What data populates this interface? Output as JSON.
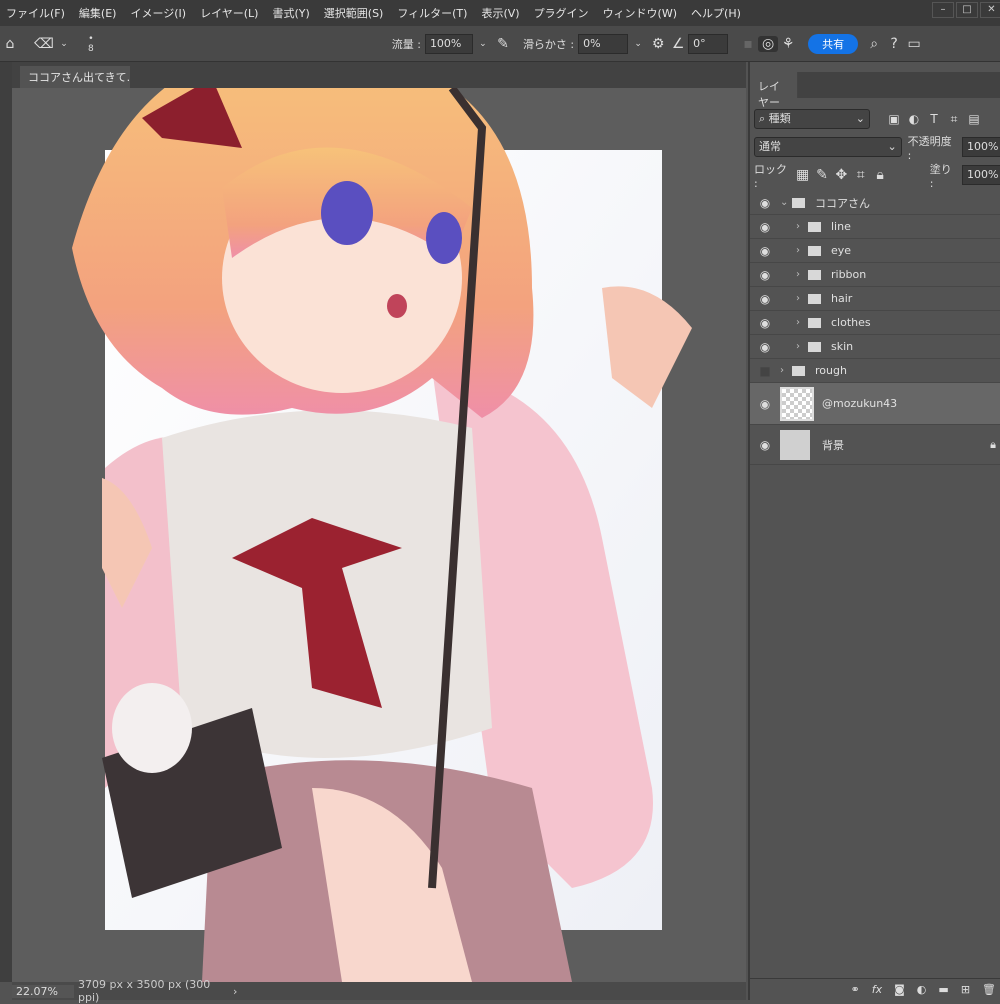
{
  "menu": [
    "ファイル(F)",
    "編集(E)",
    "イメージ(I)",
    "レイヤー(L)",
    "書式(Y)",
    "選択範囲(S)",
    "フィルター(T)",
    "表示(V)",
    "プラグイン",
    "ウィンドウ(W)",
    "ヘルプ(H)"
  ],
  "options": {
    "brush_size": "8",
    "flow_label": "流量 :",
    "flow_value": "100%",
    "smoothing_label": "滑らかさ :",
    "smoothing_value": "0%",
    "angle_value": "0°",
    "share_label": "共有"
  },
  "document": {
    "tab_title": "ココアさん出てきて.psd",
    "zoom": "22.07%",
    "size_info": "3709 px x 3500 px (300 ppi)"
  },
  "layers_panel": {
    "tab": "レイヤー",
    "filter_kind": "種類",
    "blend_mode": "通常",
    "opacity_label": "不透明度 :",
    "opacity_value": "100%",
    "lock_label": "ロック :",
    "fill_label": "塗り :",
    "fill_value": "100%",
    "layers": [
      {
        "name": "ココアさん",
        "type": "group",
        "visible": true,
        "expanded": true
      },
      {
        "name": "line",
        "type": "group",
        "visible": true
      },
      {
        "name": "eye",
        "type": "group",
        "visible": true
      },
      {
        "name": "ribbon",
        "type": "group",
        "visible": true
      },
      {
        "name": "hair",
        "type": "group",
        "visible": true
      },
      {
        "name": "clothes",
        "type": "group",
        "visible": true
      },
      {
        "name": "skin",
        "type": "group",
        "visible": true
      },
      {
        "name": "rough",
        "type": "group",
        "visible": false
      },
      {
        "name": "@mozukun43",
        "type": "layer",
        "visible": true,
        "selected": true
      },
      {
        "name": "背景",
        "type": "layer",
        "visible": true,
        "locked": true
      }
    ]
  }
}
